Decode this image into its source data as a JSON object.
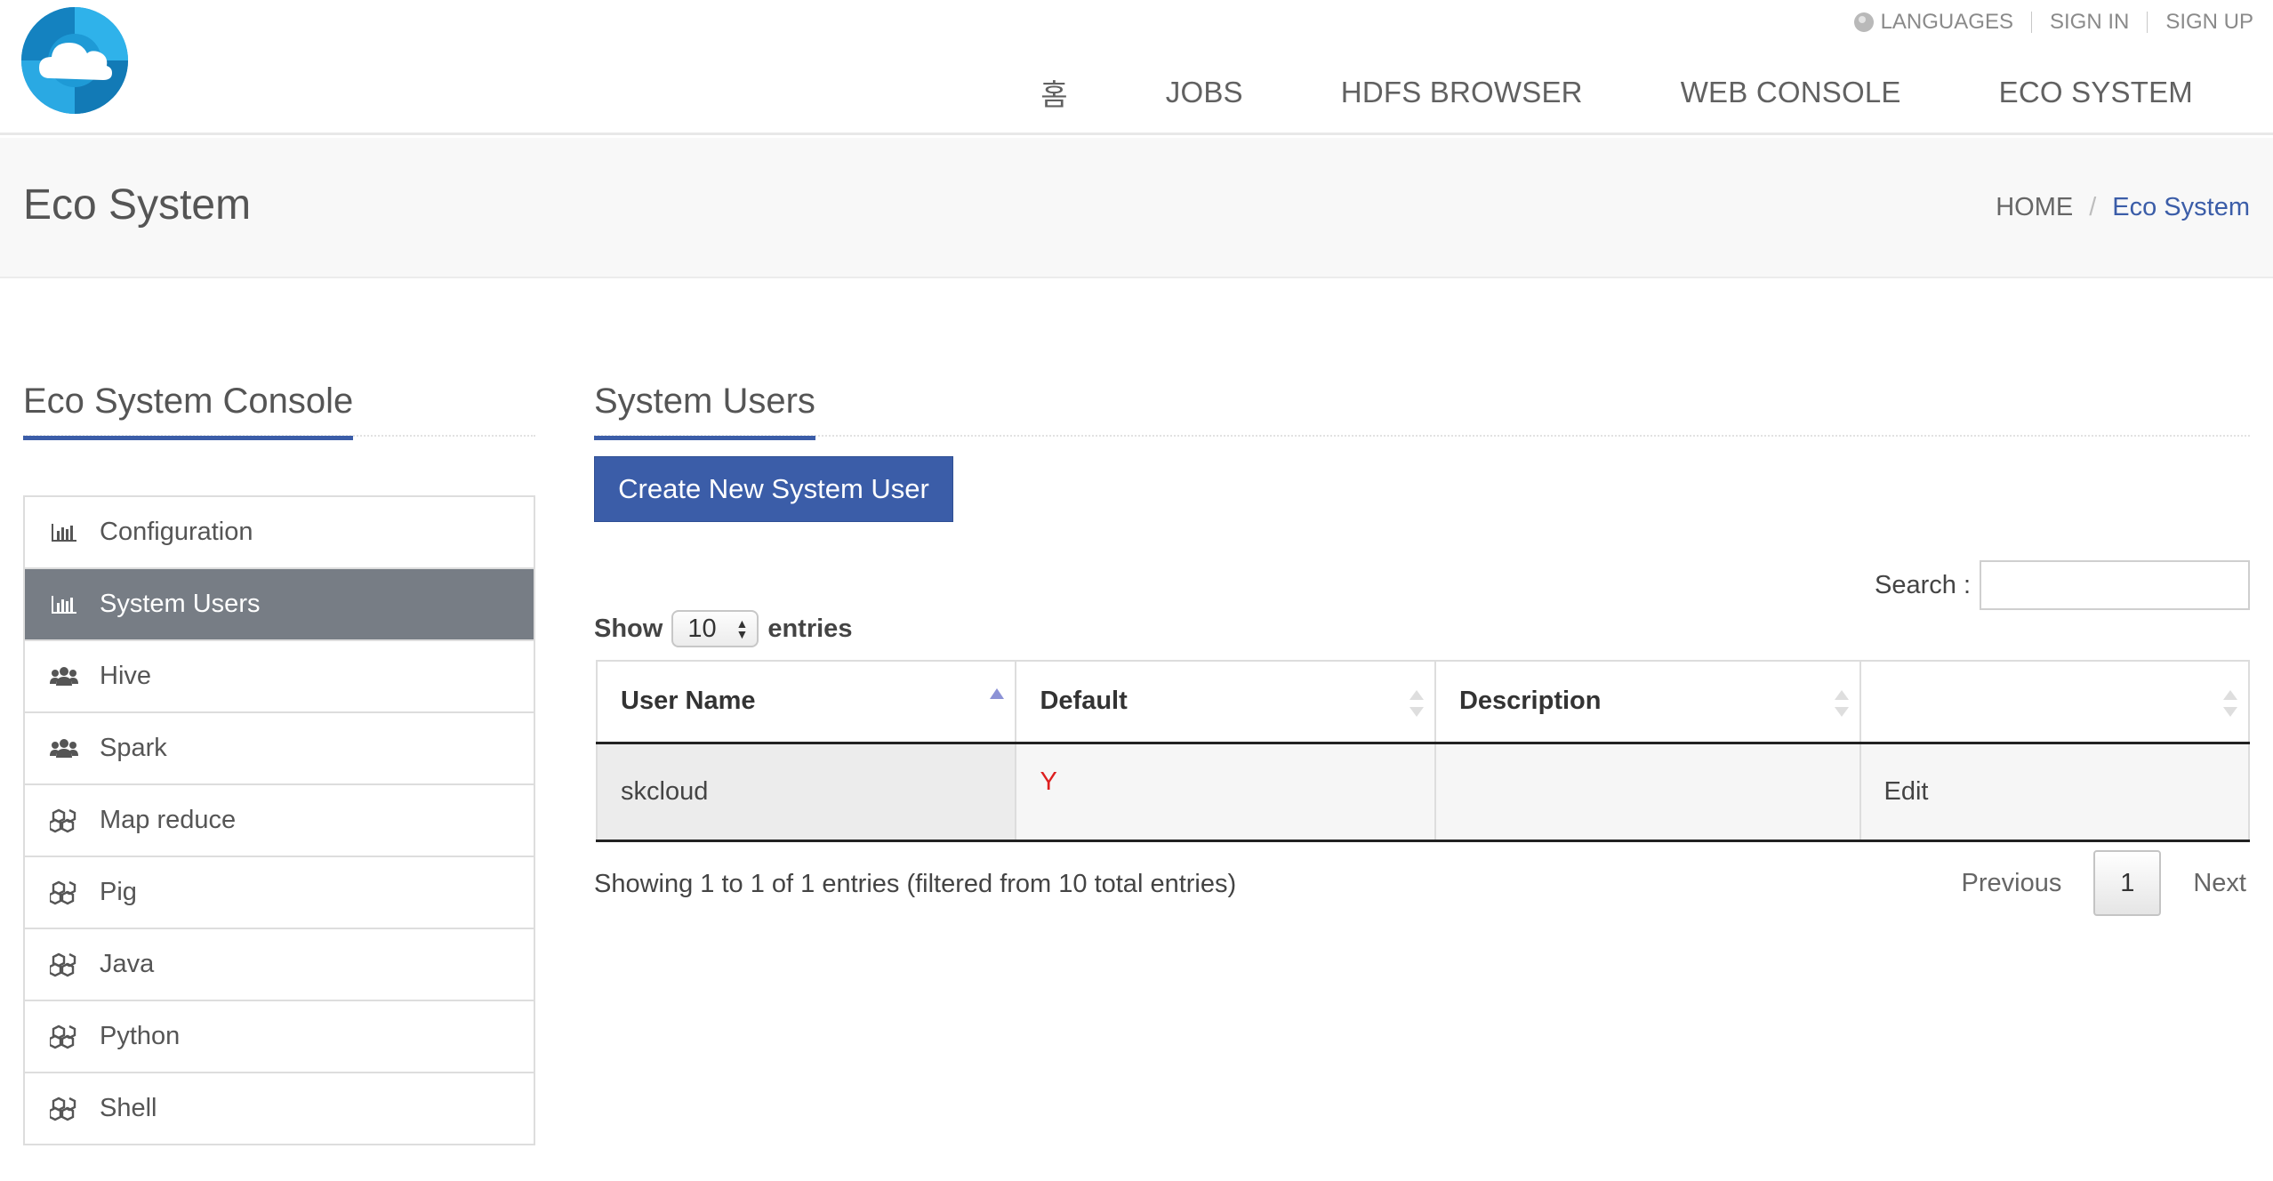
{
  "topbar": {
    "languages": "LANGUAGES",
    "sign_in": "SIGN IN",
    "sign_up": "SIGN UP"
  },
  "nav": {
    "home": "홈",
    "jobs": "JOBS",
    "hdfs": "HDFS BROWSER",
    "web_console": "WEB CONSOLE",
    "eco_system": "ECO SYSTEM"
  },
  "page": {
    "title": "Eco System"
  },
  "breadcrumb": {
    "home": "HOME",
    "separator": "/",
    "current": "Eco System"
  },
  "sidebar": {
    "heading": "Eco System Console",
    "items": [
      {
        "label": "Configuration",
        "icon": "bar-chart-icon"
      },
      {
        "label": "System Users",
        "icon": "bar-chart-icon",
        "active": true
      },
      {
        "label": "Hive",
        "icon": "users-icon"
      },
      {
        "label": "Spark",
        "icon": "users-icon"
      },
      {
        "label": "Map reduce",
        "icon": "cubes-icon"
      },
      {
        "label": "Pig",
        "icon": "cubes-icon"
      },
      {
        "label": "Java",
        "icon": "cubes-icon"
      },
      {
        "label": "Python",
        "icon": "cubes-icon"
      },
      {
        "label": "Shell",
        "icon": "cubes-icon"
      }
    ]
  },
  "main": {
    "heading": "System Users",
    "create_button": "Create New System User",
    "search_label": "Search :",
    "search_value": "",
    "show_label": "Show",
    "entries_label": "entries",
    "page_length": "10",
    "table": {
      "columns": [
        "User Name",
        "Default",
        "Description",
        ""
      ],
      "rows": [
        {
          "user_name": "skcloud",
          "default": "Y",
          "description": "",
          "action": "Edit"
        }
      ]
    },
    "info": "Showing 1 to 1 of 1 entries (filtered from 10 total entries)",
    "pagination": {
      "previous": "Previous",
      "current_page": "1",
      "next": "Next"
    }
  },
  "colors": {
    "brand": "#3b5da8",
    "active_menu": "#777d85",
    "default_flag": "#dd1f1f"
  }
}
